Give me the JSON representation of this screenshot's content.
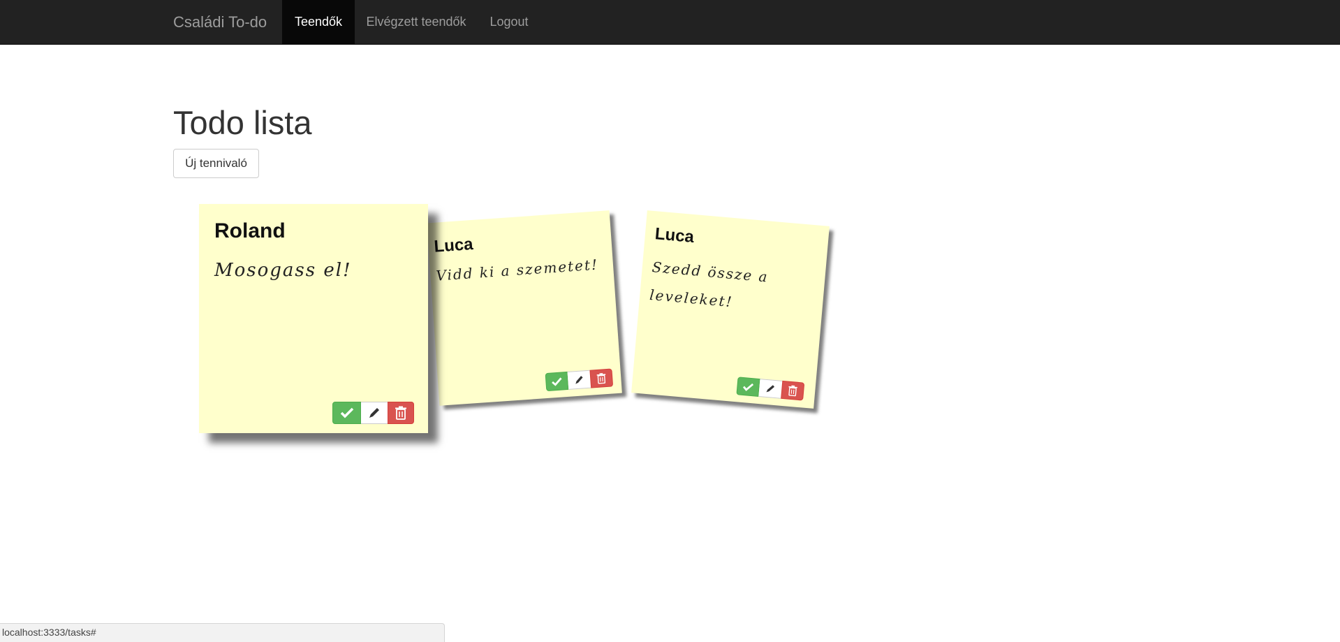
{
  "navbar": {
    "brand": "Családi To-do",
    "items": [
      {
        "label": "Teendők",
        "active": true
      },
      {
        "label": "Elvégzett teendők",
        "active": false
      },
      {
        "label": "Logout",
        "active": false
      }
    ]
  },
  "main": {
    "title": "Todo lista",
    "new_button_label": "Új tennivaló"
  },
  "notes": [
    {
      "owner": "Roland",
      "text": "Mosogass el!",
      "actions": [
        "check-icon",
        "pencil-icon",
        "trash-icon"
      ]
    },
    {
      "owner": "Luca",
      "text": "Vidd ki a szemetet!",
      "actions": [
        "check-icon",
        "pencil-icon",
        "trash-icon"
      ]
    },
    {
      "owner": "Luca",
      "text": "Szedd össze a leveleket!",
      "actions": [
        "check-icon",
        "pencil-icon",
        "trash-icon"
      ]
    }
  ],
  "status_bar": {
    "url": "localhost:3333/tasks#"
  },
  "colors": {
    "navbar_bg": "#222222",
    "navbar_active_bg": "#080808",
    "note_bg": "#ffffcc",
    "success": "#5cb85c",
    "danger": "#d9534f"
  }
}
